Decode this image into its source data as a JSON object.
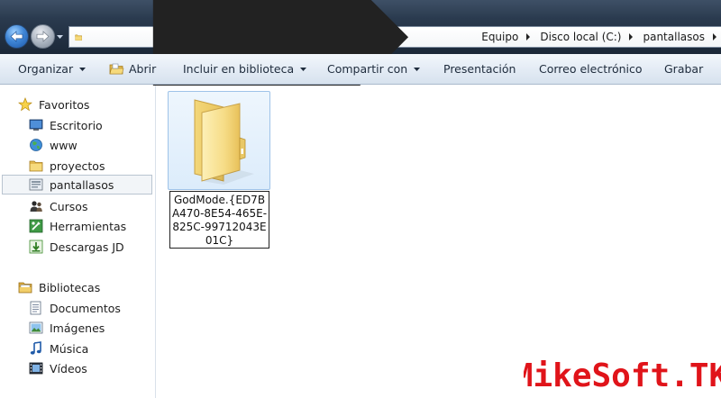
{
  "address_bar": {
    "breadcrumbs": [
      "Equipo",
      "Disco local (C:)",
      "pantallasos"
    ],
    "back_icon": "back-arrow-icon",
    "forward_icon": "forward-arrow-icon"
  },
  "command_bar": {
    "organize": "Organizar",
    "open": "Abrir",
    "include_library": "Incluir en biblioteca",
    "share_with": "Compartir con",
    "presentation": "Presentación",
    "email": "Correo electrónico",
    "burn": "Grabar"
  },
  "sidebar": {
    "favorites": {
      "label": "Favoritos",
      "items": [
        {
          "label": "Escritorio",
          "icon": "desktop-icon"
        },
        {
          "label": "www",
          "icon": "globe-icon"
        },
        {
          "label": "proyectos",
          "icon": "folder-icon"
        },
        {
          "label": "pantallasos",
          "icon": "screenshot-folder-icon",
          "selected": true
        },
        {
          "label": "Cursos",
          "icon": "people-icon"
        },
        {
          "label": "Herramientas",
          "icon": "tools-icon"
        },
        {
          "label": "Descargas JD",
          "icon": "download-icon"
        }
      ]
    },
    "libraries": {
      "label": "Bibliotecas",
      "items": [
        {
          "label": "Documentos",
          "icon": "documents-icon"
        },
        {
          "label": "Imágenes",
          "icon": "pictures-icon"
        },
        {
          "label": "Música",
          "icon": "music-icon"
        },
        {
          "label": "Vídeos",
          "icon": "videos-icon"
        }
      ]
    }
  },
  "content": {
    "items": [
      {
        "name": "GodMode.{ED7BA470-8E54-465E-825C-99712043E01C}",
        "icon": "folder-icon",
        "renaming": true
      }
    ]
  },
  "watermark": {
    "text": "MikeSoft.TK",
    "colors": {
      "fill": "#e0141a",
      "outline": "#ffffff"
    }
  },
  "colors": {
    "addressbar_dark": "#1b2838",
    "commandbar_light": "#e4ecf5",
    "selection_blue": "#dcecfb"
  }
}
